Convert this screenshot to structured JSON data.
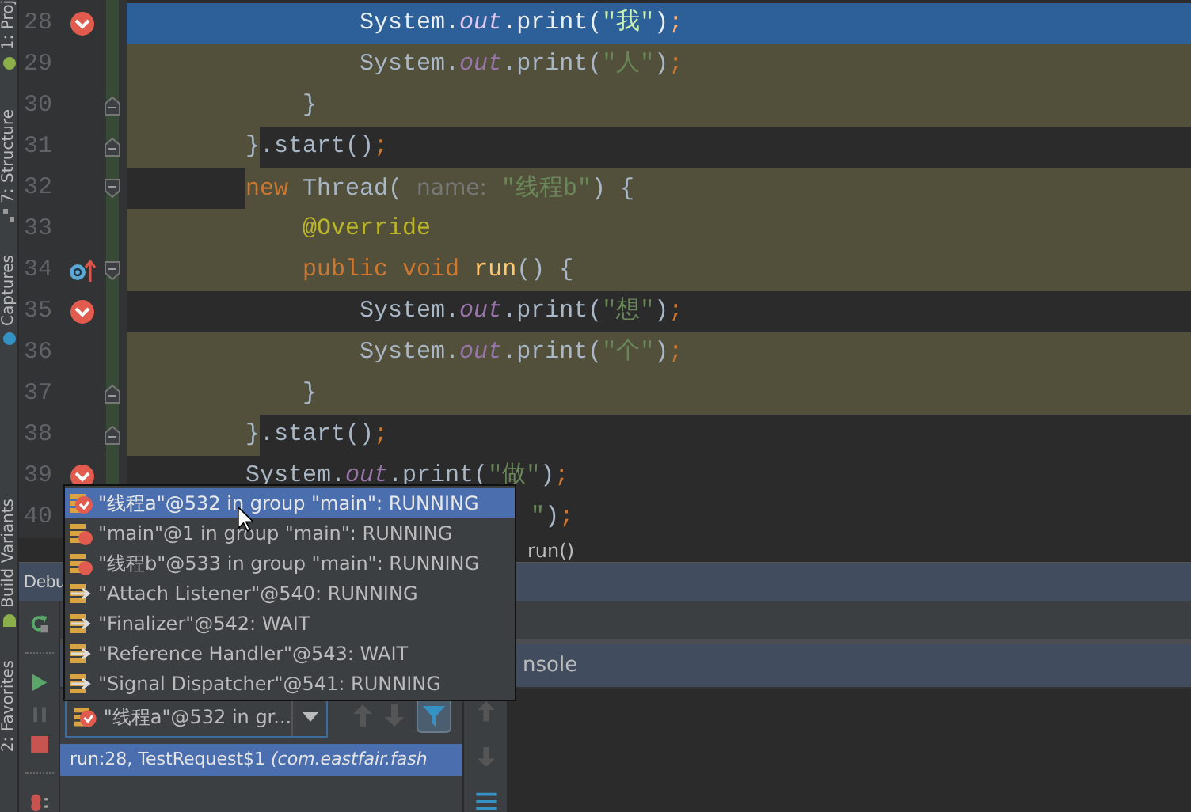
{
  "tool_strip": [
    {
      "label": "1: Proj"
    },
    {
      "label": "7: Structure"
    },
    {
      "label": "Captures"
    },
    {
      "label": "Build Variants"
    },
    {
      "label": "2: Favorites"
    }
  ],
  "editor": {
    "lines": [
      {
        "number": "28",
        "breakpoint": true,
        "overrides": false,
        "fold_start": false,
        "fold_end": false,
        "selected": true,
        "kind": "scope",
        "tokens": [
          {
            "kind": "plain",
            "text": "                System."
          },
          {
            "kind": "field",
            "text": "out"
          },
          {
            "kind": "plain",
            "text": ".print("
          },
          {
            "kind": "string",
            "text": "\"我\""
          },
          {
            "kind": "plain",
            "text": ")"
          },
          {
            "kind": "semi",
            "text": ";"
          }
        ]
      },
      {
        "number": "29",
        "breakpoint": false,
        "overrides": false,
        "fold_start": false,
        "fold_end": false,
        "selected": false,
        "kind": "scope",
        "tokens": [
          {
            "kind": "plain",
            "text": "                System."
          },
          {
            "kind": "field",
            "text": "out"
          },
          {
            "kind": "plain",
            "text": ".print("
          },
          {
            "kind": "string",
            "text": "\"人\""
          },
          {
            "kind": "plain",
            "text": ")"
          },
          {
            "kind": "semi",
            "text": ";"
          }
        ]
      },
      {
        "number": "30",
        "breakpoint": false,
        "overrides": false,
        "fold_start": false,
        "fold_end": true,
        "selected": false,
        "kind": "scope",
        "tokens": [
          {
            "kind": "plain",
            "text": "            }"
          }
        ]
      },
      {
        "number": "31",
        "breakpoint": false,
        "overrides": false,
        "fold_start": false,
        "fold_end": true,
        "selected": false,
        "kind": "scope_indent",
        "tokens": [
          {
            "kind": "plain",
            "text": "        }.start()"
          },
          {
            "kind": "semi",
            "text": ";"
          }
        ]
      },
      {
        "number": "32",
        "breakpoint": false,
        "overrides": false,
        "fold_start": true,
        "fold_end": false,
        "selected": false,
        "kind": "scope_tail",
        "tokens": [
          {
            "kind": "keyword",
            "text": "        new"
          },
          {
            "kind": "plain",
            "text": " Thread( "
          },
          {
            "kind": "hint",
            "text": "name:"
          },
          {
            "kind": "string",
            "text": " \"线程b\""
          },
          {
            "kind": "plain",
            "text": ") {"
          }
        ]
      },
      {
        "number": "33",
        "breakpoint": false,
        "overrides": false,
        "fold_start": false,
        "fold_end": false,
        "selected": false,
        "kind": "scope",
        "tokens": [
          {
            "kind": "annotation",
            "text": "            @Override"
          }
        ]
      },
      {
        "number": "34",
        "breakpoint": false,
        "overrides": true,
        "fold_start": true,
        "fold_end": false,
        "selected": false,
        "kind": "scope",
        "tokens": [
          {
            "kind": "keyword",
            "text": "            public void "
          },
          {
            "kind": "method",
            "text": "run"
          },
          {
            "kind": "plain",
            "text": "() {"
          }
        ]
      },
      {
        "number": "35",
        "breakpoint": true,
        "overrides": false,
        "fold_start": false,
        "fold_end": false,
        "selected": false,
        "kind": "plain",
        "tokens": [
          {
            "kind": "plain",
            "text": "                System."
          },
          {
            "kind": "field",
            "text": "out"
          },
          {
            "kind": "plain",
            "text": ".print("
          },
          {
            "kind": "string",
            "text": "\"想\""
          },
          {
            "kind": "plain",
            "text": ")"
          },
          {
            "kind": "semi",
            "text": ";"
          }
        ]
      },
      {
        "number": "36",
        "breakpoint": false,
        "overrides": false,
        "fold_start": false,
        "fold_end": false,
        "selected": false,
        "kind": "scope",
        "tokens": [
          {
            "kind": "plain",
            "text": "                System."
          },
          {
            "kind": "field",
            "text": "out"
          },
          {
            "kind": "plain",
            "text": ".print("
          },
          {
            "kind": "string",
            "text": "\"个\""
          },
          {
            "kind": "plain",
            "text": ")"
          },
          {
            "kind": "semi",
            "text": ";"
          }
        ]
      },
      {
        "number": "37",
        "breakpoint": false,
        "overrides": false,
        "fold_start": false,
        "fold_end": true,
        "selected": false,
        "kind": "scope",
        "tokens": [
          {
            "kind": "plain",
            "text": "            }"
          }
        ]
      },
      {
        "number": "38",
        "breakpoint": false,
        "overrides": false,
        "fold_start": false,
        "fold_end": true,
        "selected": false,
        "kind": "scope_indent",
        "tokens": [
          {
            "kind": "plain",
            "text": "        }.start()"
          },
          {
            "kind": "semi",
            "text": ";"
          }
        ]
      },
      {
        "number": "39",
        "breakpoint": true,
        "overrides": false,
        "fold_start": false,
        "fold_end": false,
        "selected": false,
        "kind": "plain",
        "tokens": [
          {
            "kind": "plain",
            "text": "        System."
          },
          {
            "kind": "field",
            "text": "out"
          },
          {
            "kind": "plain",
            "text": ".print("
          },
          {
            "kind": "string",
            "text": "\"做\""
          },
          {
            "kind": "plain",
            "text": ")"
          },
          {
            "kind": "semi",
            "text": ";"
          }
        ]
      },
      {
        "number": "40",
        "selected": false,
        "kind": "plain",
        "tokens": [
          {
            "kind": "string",
            "text": "                            \""
          },
          {
            "kind": "plain",
            "text": ")"
          },
          {
            "kind": "semi",
            "text": ";"
          }
        ]
      }
    ]
  },
  "breadcrumb": "run()",
  "debug_panel": {
    "title": "Debu",
    "console_tab": "nsole",
    "thread_combo": "\"线程a\"@532 in gr...",
    "frames": [
      {
        "text": "run:28, TestRequest$1 *(com.eastfair.fash*",
        "selected": true
      }
    ]
  },
  "thread_popup": [
    {
      "kind": "breakpoint",
      "label": "\"线程a\"@532 in group \"main\": RUNNING",
      "selected": true
    },
    {
      "kind": "suspended",
      "label": "\"main\"@1 in group \"main\": RUNNING",
      "selected": false
    },
    {
      "kind": "suspended",
      "label": "\"线程b\"@533 in group \"main\": RUNNING",
      "selected": false
    },
    {
      "kind": "system",
      "label": "\"Attach Listener\"@540: RUNNING",
      "selected": false
    },
    {
      "kind": "system",
      "label": "\"Finalizer\"@542: WAIT",
      "selected": false
    },
    {
      "kind": "system",
      "label": "\"Reference Handler\"@543: WAIT",
      "selected": false
    },
    {
      "kind": "system",
      "label": "\"Signal Dispatcher\"@541: RUNNING",
      "selected": false
    }
  ]
}
